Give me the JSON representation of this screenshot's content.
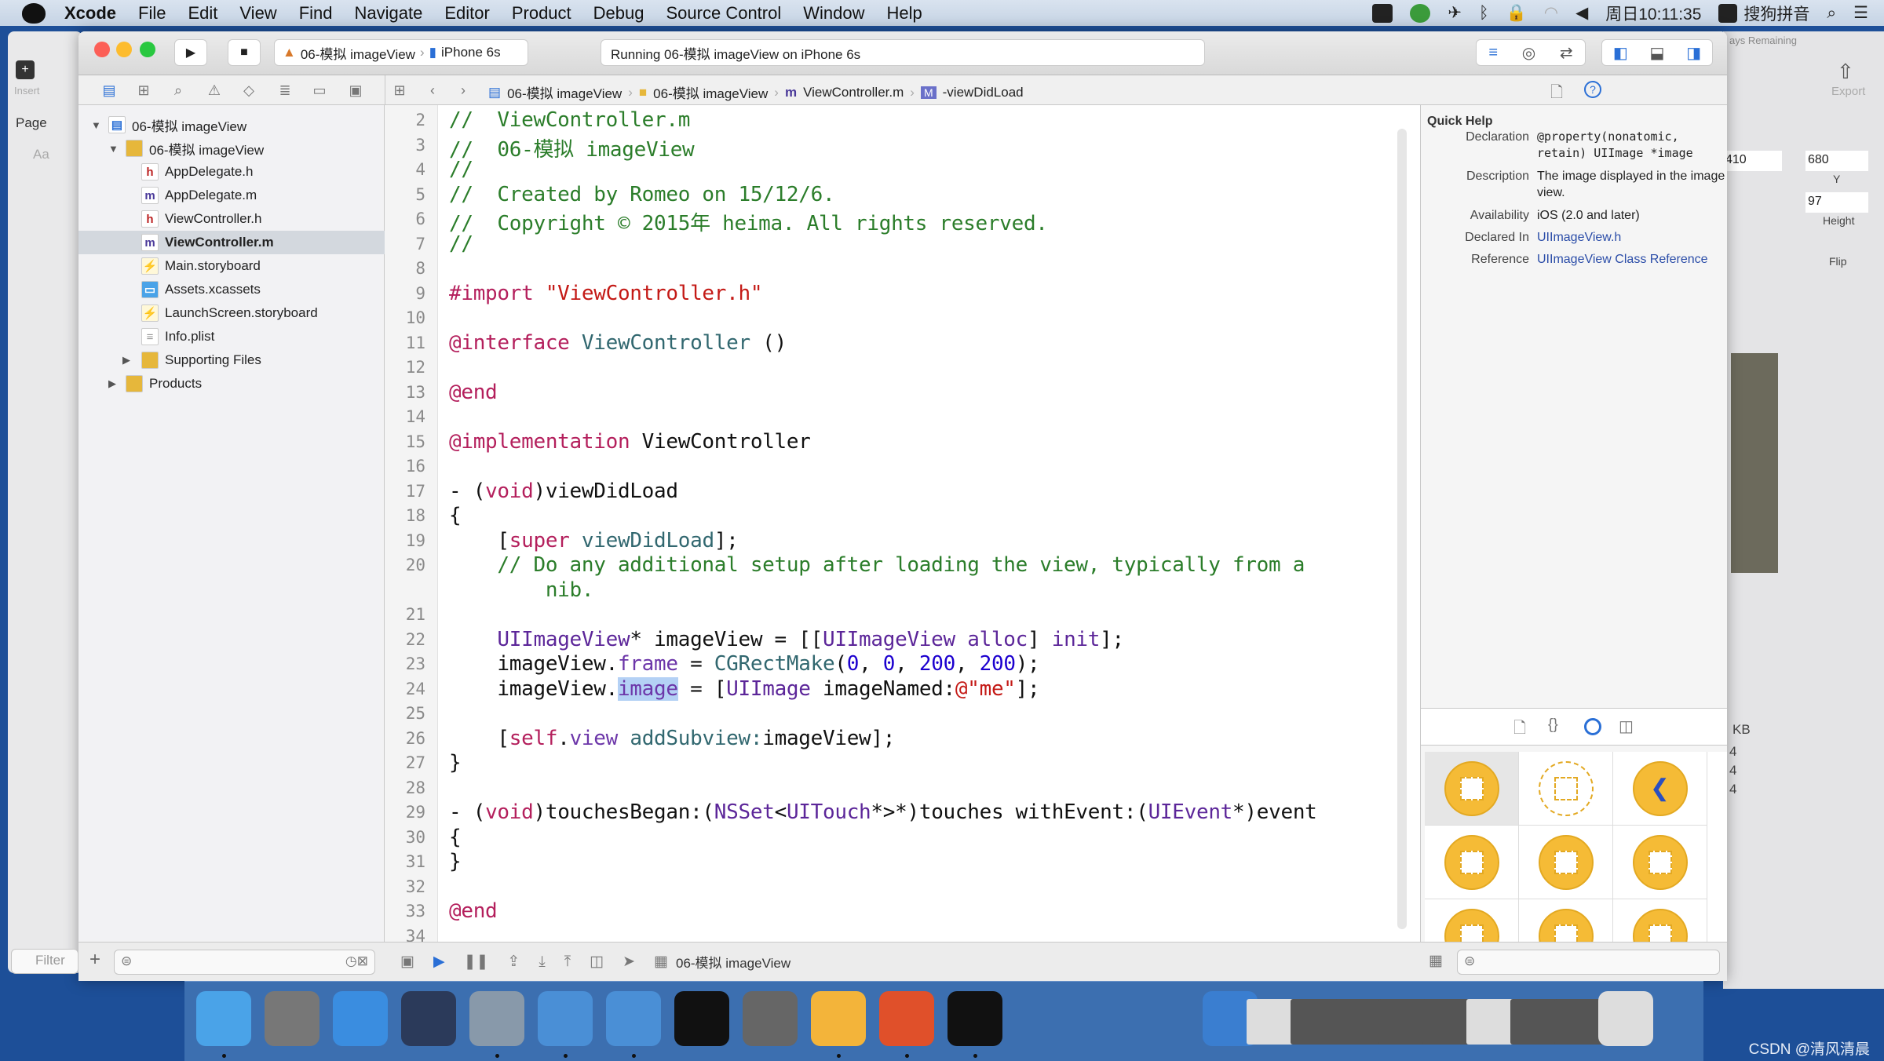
{
  "menubar": {
    "app": "Xcode",
    "items": [
      "File",
      "Edit",
      "View",
      "Find",
      "Navigate",
      "Editor",
      "Product",
      "Debug",
      "Source Control",
      "Window",
      "Help"
    ],
    "clock": "周日10:11:35",
    "input_method": "搜狗拼音"
  },
  "toolbar": {
    "scheme": "06-模拟 imageView",
    "device": "iPhone 6s",
    "status": "Running 06-模拟 imageView on iPhone 6s"
  },
  "jumpbar": {
    "crumbs": [
      "06-模拟 imageView",
      "06-模拟 imageView",
      "ViewController.m",
      "-viewDidLoad"
    ]
  },
  "navigator": {
    "items": [
      {
        "label": "06-模拟 imageView",
        "level": 0,
        "icon": "project",
        "expanded": true
      },
      {
        "label": "06-模拟 imageView",
        "level": 1,
        "icon": "folder",
        "expanded": true
      },
      {
        "label": "AppDelegate.h",
        "level": 2,
        "icon": "h"
      },
      {
        "label": "AppDelegate.m",
        "level": 2,
        "icon": "m"
      },
      {
        "label": "ViewController.h",
        "level": 2,
        "icon": "h"
      },
      {
        "label": "ViewController.m",
        "level": 2,
        "icon": "m",
        "selected": true
      },
      {
        "label": "Main.storyboard",
        "level": 2,
        "icon": "storyboard"
      },
      {
        "label": "Assets.xcassets",
        "level": 2,
        "icon": "assets"
      },
      {
        "label": "LaunchScreen.storyboard",
        "level": 2,
        "icon": "storyboard"
      },
      {
        "label": "Info.plist",
        "level": 2,
        "icon": "plist"
      },
      {
        "label": "Supporting Files",
        "level": 2,
        "icon": "folder",
        "expanded": false
      },
      {
        "label": "Products",
        "level": 1,
        "icon": "folder",
        "expanded": false
      }
    ]
  },
  "editor": {
    "lines": [
      {
        "n": "2",
        "t": [
          [
            "//  ViewController.m",
            "c"
          ]
        ]
      },
      {
        "n": "3",
        "t": [
          [
            "//  06-模拟 imageView",
            "c"
          ]
        ]
      },
      {
        "n": "4",
        "t": [
          [
            "//",
            "c"
          ]
        ]
      },
      {
        "n": "5",
        "t": [
          [
            "//  Created by Romeo on 15/12/6.",
            "c"
          ]
        ]
      },
      {
        "n": "6",
        "t": [
          [
            "//  Copyright © 2015年 heima. All rights reserved.",
            "c"
          ]
        ]
      },
      {
        "n": "7",
        "t": [
          [
            "//",
            "c"
          ]
        ]
      },
      {
        "n": "8",
        "t": []
      },
      {
        "n": "9",
        "t": [
          [
            "#import ",
            "k"
          ],
          [
            "\"ViewController.h\"",
            "s"
          ]
        ]
      },
      {
        "n": "10",
        "t": []
      },
      {
        "n": "11",
        "t": [
          [
            "@interface",
            "k"
          ],
          [
            " ",
            ""
          ],
          [
            "ViewController",
            "m"
          ],
          [
            " ()",
            ""
          ]
        ]
      },
      {
        "n": "12",
        "t": []
      },
      {
        "n": "13",
        "t": [
          [
            "@end",
            "k"
          ]
        ]
      },
      {
        "n": "14",
        "t": []
      },
      {
        "n": "15",
        "t": [
          [
            "@implementation",
            "k"
          ],
          [
            " ViewController",
            ""
          ]
        ]
      },
      {
        "n": "16",
        "t": []
      },
      {
        "n": "17",
        "t": [
          [
            "- (",
            ""
          ],
          [
            "void",
            "k"
          ],
          [
            ")viewDidLoad",
            ""
          ]
        ]
      },
      {
        "n": "18",
        "t": [
          [
            "{",
            ""
          ]
        ]
      },
      {
        "n": "19",
        "t": [
          [
            "    [",
            ""
          ],
          [
            "super",
            "k"
          ],
          [
            " ",
            ""
          ],
          [
            "viewDidLoad",
            "m"
          ],
          [
            "];",
            ""
          ]
        ]
      },
      {
        "n": "20",
        "t": [
          [
            "    // Do any additional setup after loading the view, typically from a",
            "c"
          ]
        ]
      },
      {
        "n": "",
        "t": [
          [
            "        nib.",
            "c"
          ]
        ]
      },
      {
        "n": "21",
        "t": []
      },
      {
        "n": "22",
        "t": [
          [
            "    ",
            ""
          ],
          [
            "UIImageView",
            "cls"
          ],
          [
            "* imageView = [[",
            ""
          ],
          [
            "UIImageView",
            "cls"
          ],
          [
            " ",
            ""
          ],
          [
            "alloc",
            "cls"
          ],
          [
            "] ",
            ""
          ],
          [
            "init",
            "cls"
          ],
          [
            "];",
            ""
          ]
        ]
      },
      {
        "n": "23",
        "t": [
          [
            "    imageView.",
            ""
          ],
          [
            "frame",
            "p"
          ],
          [
            " = ",
            ""
          ],
          [
            "CGRectMake",
            "m"
          ],
          [
            "(",
            ""
          ],
          [
            "0",
            "n"
          ],
          [
            ", ",
            ""
          ],
          [
            "0",
            "n"
          ],
          [
            ", ",
            ""
          ],
          [
            "200",
            "n"
          ],
          [
            ", ",
            ""
          ],
          [
            "200",
            "n"
          ],
          [
            ");",
            ""
          ]
        ]
      },
      {
        "n": "24",
        "t": [
          [
            "    imageView.",
            ""
          ],
          [
            "image",
            "p sel"
          ],
          [
            " = [",
            ""
          ],
          [
            "UIImage",
            "cls"
          ],
          [
            " ",
            ""
          ],
          [
            "imageNamed:",
            ""
          ],
          [
            "@\"me\"",
            "s"
          ],
          [
            "];",
            ""
          ]
        ]
      },
      {
        "n": "25",
        "t": []
      },
      {
        "n": "26",
        "t": [
          [
            "    [",
            ""
          ],
          [
            "self",
            "k"
          ],
          [
            ".",
            ""
          ],
          [
            "view",
            "p"
          ],
          [
            " ",
            ""
          ],
          [
            "addSubview:",
            "m"
          ],
          [
            "imageView];",
            ""
          ]
        ]
      },
      {
        "n": "27",
        "t": [
          [
            "}",
            ""
          ]
        ]
      },
      {
        "n": "28",
        "t": []
      },
      {
        "n": "29",
        "t": [
          [
            "- (",
            ""
          ],
          [
            "void",
            "k"
          ],
          [
            ")touchesBegan:(",
            ""
          ],
          [
            "NSSet",
            "cls"
          ],
          [
            "<",
            ""
          ],
          [
            "UITouch",
            "cls"
          ],
          [
            "*>*)touches withEvent:(",
            ""
          ],
          [
            "UIEvent",
            "cls"
          ],
          [
            "*)event",
            ""
          ]
        ]
      },
      {
        "n": "30",
        "t": [
          [
            "{",
            ""
          ]
        ]
      },
      {
        "n": "31",
        "t": [
          [
            "}",
            ""
          ]
        ]
      },
      {
        "n": "32",
        "t": []
      },
      {
        "n": "33",
        "t": [
          [
            "@end",
            "k"
          ]
        ]
      },
      {
        "n": "34",
        "t": []
      }
    ]
  },
  "quick_help": {
    "title": "Quick Help",
    "rows": [
      {
        "label": "Declaration",
        "value": "@property(nonatomic, retain) UIImage *image",
        "mono": true
      },
      {
        "label": "Description",
        "value": "The image displayed in the image view."
      },
      {
        "label": "Availability",
        "value": "iOS (2.0 and later)"
      },
      {
        "label": "Declared In",
        "value": "UIImageView.h",
        "link": true
      },
      {
        "label": "Reference",
        "value": "UIImageView Class Reference",
        "link": true
      }
    ]
  },
  "library": {
    "items": [
      "view",
      "image-view-outline",
      "back-button",
      "table-view",
      "collection-view",
      "tab-bar",
      "split-view",
      "page-view",
      "avatar-view"
    ],
    "accent": "#f5bb36"
  },
  "bottom": {
    "debug_target": "06-模拟 imageView",
    "filter_placeholder": "Filter"
  },
  "left_window": {
    "insert": "Insert",
    "page": "Page",
    "aa": "Aa"
  },
  "right_window": {
    "days": "ays Remaining",
    "export": "Export",
    "x_value": "410",
    "y_value": "680",
    "y_label": "Y",
    "h_value": "97",
    "h_label": "Height",
    "flip": "Flip",
    "kb": "KB",
    "counts": [
      "4",
      "4",
      "4"
    ]
  },
  "dock": {
    "apps": [
      "finder",
      "launchpad",
      "safari",
      "mouse",
      "photo-booth",
      "xcode",
      "simulator",
      "terminal",
      "system-preferences",
      "sketch",
      "powerpoint",
      "console",
      "qq-player",
      "preview",
      "screens1",
      "screens2",
      "screens3",
      "screens4",
      "screens5",
      "screens6",
      "screens7",
      "trash"
    ]
  },
  "watermark": "CSDN @清风清晨"
}
